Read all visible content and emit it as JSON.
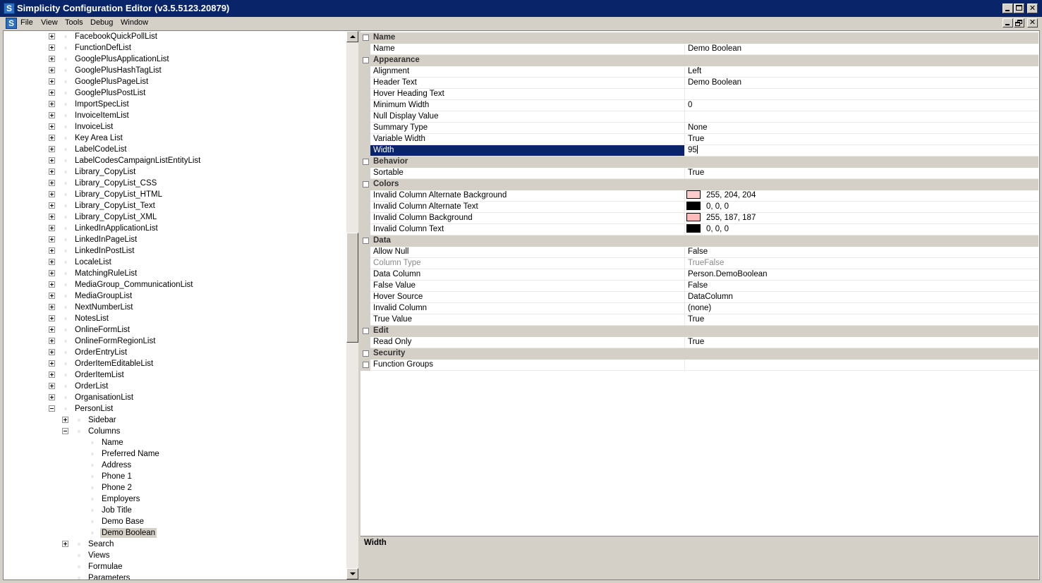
{
  "window": {
    "title": "Simplicity Configuration Editor (v3.5.5123.20879)",
    "title_bar_color": "#0a246a",
    "app_icon_letter": "S"
  },
  "menu": {
    "items": [
      "File",
      "View",
      "Tools",
      "Debug",
      "Window"
    ]
  },
  "tree": {
    "nodes": [
      {
        "label": "FacebookQuickPollList",
        "level": 0,
        "expander": "plus"
      },
      {
        "label": "FunctionDefList",
        "level": 0,
        "expander": "plus"
      },
      {
        "label": "GooglePlusApplicationList",
        "level": 0,
        "expander": "plus"
      },
      {
        "label": "GooglePlusHashTagList",
        "level": 0,
        "expander": "plus"
      },
      {
        "label": "GooglePlusPageList",
        "level": 0,
        "expander": "plus"
      },
      {
        "label": "GooglePlusPostList",
        "level": 0,
        "expander": "plus"
      },
      {
        "label": "ImportSpecList",
        "level": 0,
        "expander": "plus"
      },
      {
        "label": "InvoiceItemList",
        "level": 0,
        "expander": "plus"
      },
      {
        "label": "InvoiceList",
        "level": 0,
        "expander": "plus"
      },
      {
        "label": "Key Area List",
        "level": 0,
        "expander": "plus"
      },
      {
        "label": "LabelCodeList",
        "level": 0,
        "expander": "plus"
      },
      {
        "label": "LabelCodesCampaignListEntityList",
        "level": 0,
        "expander": "plus"
      },
      {
        "label": "Library_CopyList",
        "level": 0,
        "expander": "plus"
      },
      {
        "label": "Library_CopyList_CSS",
        "level": 0,
        "expander": "plus"
      },
      {
        "label": "Library_CopyList_HTML",
        "level": 0,
        "expander": "plus"
      },
      {
        "label": "Library_CopyList_Text",
        "level": 0,
        "expander": "plus"
      },
      {
        "label": "Library_CopyList_XML",
        "level": 0,
        "expander": "plus"
      },
      {
        "label": "LinkedInApplicationList",
        "level": 0,
        "expander": "plus"
      },
      {
        "label": "LinkedInPageList",
        "level": 0,
        "expander": "plus"
      },
      {
        "label": "LinkedInPostList",
        "level": 0,
        "expander": "plus"
      },
      {
        "label": "LocaleList",
        "level": 0,
        "expander": "plus"
      },
      {
        "label": "MatchingRuleList",
        "level": 0,
        "expander": "plus"
      },
      {
        "label": "MediaGroup_CommunicationList",
        "level": 0,
        "expander": "plus"
      },
      {
        "label": "MediaGroupList",
        "level": 0,
        "expander": "plus"
      },
      {
        "label": "NextNumberList",
        "level": 0,
        "expander": "plus"
      },
      {
        "label": "NotesList",
        "level": 0,
        "expander": "plus"
      },
      {
        "label": "OnlineFormList",
        "level": 0,
        "expander": "plus"
      },
      {
        "label": "OnlineFormRegionList",
        "level": 0,
        "expander": "plus"
      },
      {
        "label": "OrderEntryList",
        "level": 0,
        "expander": "plus"
      },
      {
        "label": "OrderItemEditableList",
        "level": 0,
        "expander": "plus"
      },
      {
        "label": "OrderItemList",
        "level": 0,
        "expander": "plus"
      },
      {
        "label": "OrderList",
        "level": 0,
        "expander": "plus"
      },
      {
        "label": "OrganisationList",
        "level": 0,
        "expander": "plus"
      },
      {
        "label": "PersonList",
        "level": 0,
        "expander": "minus"
      },
      {
        "label": "Sidebar",
        "level": 1,
        "expander": "plus"
      },
      {
        "label": "Columns",
        "level": 1,
        "expander": "minus"
      },
      {
        "label": "Name",
        "level": 2,
        "expander": "none"
      },
      {
        "label": "Preferred Name",
        "level": 2,
        "expander": "none"
      },
      {
        "label": "Address",
        "level": 2,
        "expander": "none"
      },
      {
        "label": "Phone 1",
        "level": 2,
        "expander": "none"
      },
      {
        "label": "Phone 2",
        "level": 2,
        "expander": "none"
      },
      {
        "label": "Employers",
        "level": 2,
        "expander": "none"
      },
      {
        "label": "Job Title",
        "level": 2,
        "expander": "none"
      },
      {
        "label": "Demo Base",
        "level": 2,
        "expander": "none"
      },
      {
        "label": "Demo Boolean",
        "level": 2,
        "expander": "none",
        "selected": true
      },
      {
        "label": "Search",
        "level": 1,
        "expander": "plus"
      },
      {
        "label": "Views",
        "level": 1,
        "expander": "none"
      },
      {
        "label": "Formulae",
        "level": 1,
        "expander": "none"
      },
      {
        "label": "Parameters",
        "level": 1,
        "expander": "none"
      }
    ]
  },
  "properties": {
    "rows": [
      {
        "type": "category",
        "label": "Name"
      },
      {
        "type": "prop",
        "name": "Name",
        "value": "Demo Boolean"
      },
      {
        "type": "category",
        "label": "Appearance"
      },
      {
        "type": "prop",
        "name": "Alignment",
        "value": "Left"
      },
      {
        "type": "prop",
        "name": "Header Text",
        "value": "Demo Boolean"
      },
      {
        "type": "prop",
        "name": "Hover Heading Text",
        "value": ""
      },
      {
        "type": "prop",
        "name": "Minimum Width",
        "value": "0"
      },
      {
        "type": "prop",
        "name": "Null Display Value",
        "value": ""
      },
      {
        "type": "prop",
        "name": "Summary Type",
        "value": "None"
      },
      {
        "type": "prop",
        "name": "Variable Width",
        "value": "True"
      },
      {
        "type": "prop",
        "name": "Width",
        "value": "95",
        "selected": true
      },
      {
        "type": "category",
        "label": "Behavior"
      },
      {
        "type": "prop",
        "name": "Sortable",
        "value": "True"
      },
      {
        "type": "category",
        "label": "Colors"
      },
      {
        "type": "prop",
        "name": "Invalid Column Alternate Background",
        "value": "255, 204, 204",
        "swatch": "#ffcccc"
      },
      {
        "type": "prop",
        "name": "Invalid Column Alternate Text",
        "value": "0, 0, 0",
        "swatch": "#000000"
      },
      {
        "type": "prop",
        "name": "Invalid Column Background",
        "value": "255, 187, 187",
        "swatch": "#ffbbbb"
      },
      {
        "type": "prop",
        "name": "Invalid Column Text",
        "value": "0, 0, 0",
        "swatch": "#000000"
      },
      {
        "type": "category",
        "label": "Data"
      },
      {
        "type": "prop",
        "name": "Allow Null",
        "value": "False"
      },
      {
        "type": "prop",
        "name": "Column Type",
        "value": "TrueFalse",
        "disabled": true
      },
      {
        "type": "prop",
        "name": "Data Column",
        "value": "Person.DemoBoolean"
      },
      {
        "type": "prop",
        "name": "False Value",
        "value": "False"
      },
      {
        "type": "prop",
        "name": "Hover Source",
        "value": "DataColumn"
      },
      {
        "type": "prop",
        "name": "Invalid Column",
        "value": "(none)"
      },
      {
        "type": "prop",
        "name": "True Value",
        "value": "True"
      },
      {
        "type": "category",
        "label": "Edit"
      },
      {
        "type": "prop",
        "name": "Read Only",
        "value": "True"
      },
      {
        "type": "category",
        "label": "Security"
      },
      {
        "type": "prop",
        "name": "Function Groups",
        "value": "",
        "expandable": true
      }
    ]
  },
  "description": {
    "title": "Width"
  },
  "colors": {
    "selection": "#0a246a",
    "panel": "#d4d0c8"
  }
}
